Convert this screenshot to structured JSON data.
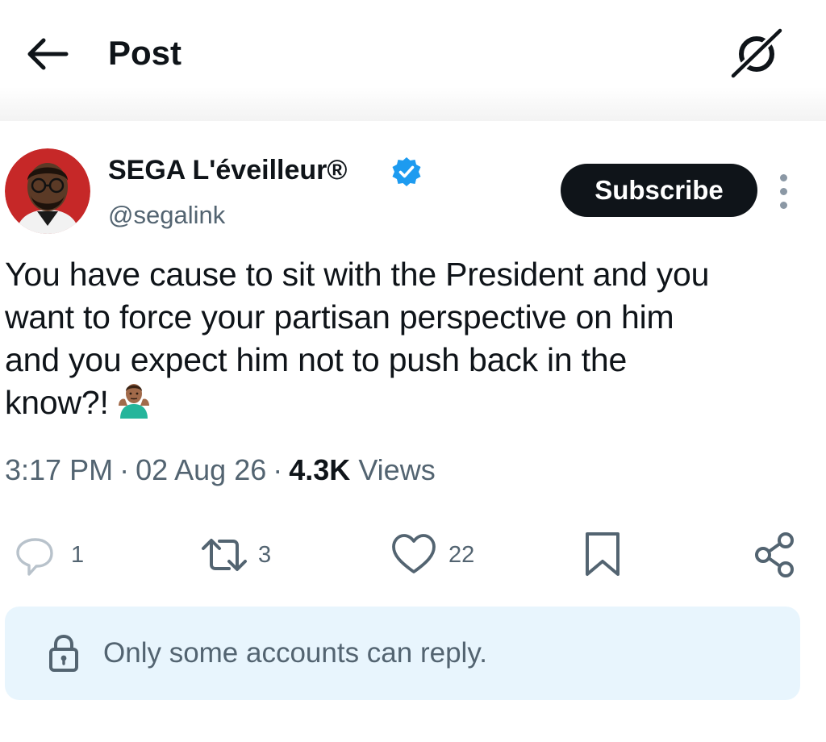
{
  "header": {
    "title": "Post",
    "back_icon": "arrow-left-icon",
    "grok_icon": "grok-icon"
  },
  "author": {
    "name": "SEGA L'éveilleur®",
    "handle": "@segalink",
    "verified": true,
    "badge_color": "#1d9bf0",
    "avatar_bg": "#c62828"
  },
  "subscribe_label": "Subscribe",
  "tweet": {
    "lines": [
      "You have cause to sit with the President and you",
      "want to force your partisan perspective on him",
      "and you expect him not to push back in the",
      "know?!"
    ],
    "emoji": "person-shrugging-emoji"
  },
  "meta": {
    "time": "3:17 PM",
    "separator": "·",
    "date": "02 Aug 26",
    "views_count": "4.3K",
    "views_label": "Views"
  },
  "actions": {
    "replies": "1",
    "reposts": "3",
    "likes": "22"
  },
  "reply_restriction": {
    "text": "Only some accounts can reply.",
    "background": "#e8f5fd"
  }
}
